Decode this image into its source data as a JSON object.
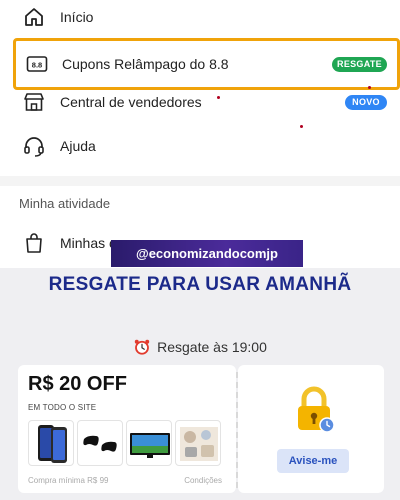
{
  "menu": {
    "items": [
      {
        "label": "Início",
        "icon": "home-icon"
      },
      {
        "label": "Cupons Relâmpago do 8.8",
        "icon": "coupon-icon",
        "badge": "RESGATE"
      },
      {
        "label": "Central de vendedores",
        "icon": "store-icon",
        "badge": "NOVO"
      },
      {
        "label": "Ajuda",
        "icon": "headset-icon"
      }
    ],
    "section_title": "Minha atividade",
    "activity_items": [
      {
        "label": "Minhas c",
        "icon": "bag-icon"
      }
    ]
  },
  "watermark": "@economizandocomjp",
  "promo": {
    "headline": "RESGATE PARA USAR AMANHÃ",
    "time_label": "Resgate às 19:00",
    "coupon": {
      "value": "R$ 20 OFF",
      "scope": "EM TODO O SITE",
      "min_purchase": "Compra mínima R$ 99",
      "conditions": "Condições",
      "products": [
        "phone",
        "controllers",
        "tv",
        "kitchenware"
      ],
      "action": "Avise-me"
    }
  },
  "colors": {
    "highlight_border": "#f0a30a",
    "resgate_badge": "#1fa653",
    "novo_badge": "#2f86f5",
    "headline": "#1c2a8a",
    "notify_button_text": "#2a52be"
  }
}
